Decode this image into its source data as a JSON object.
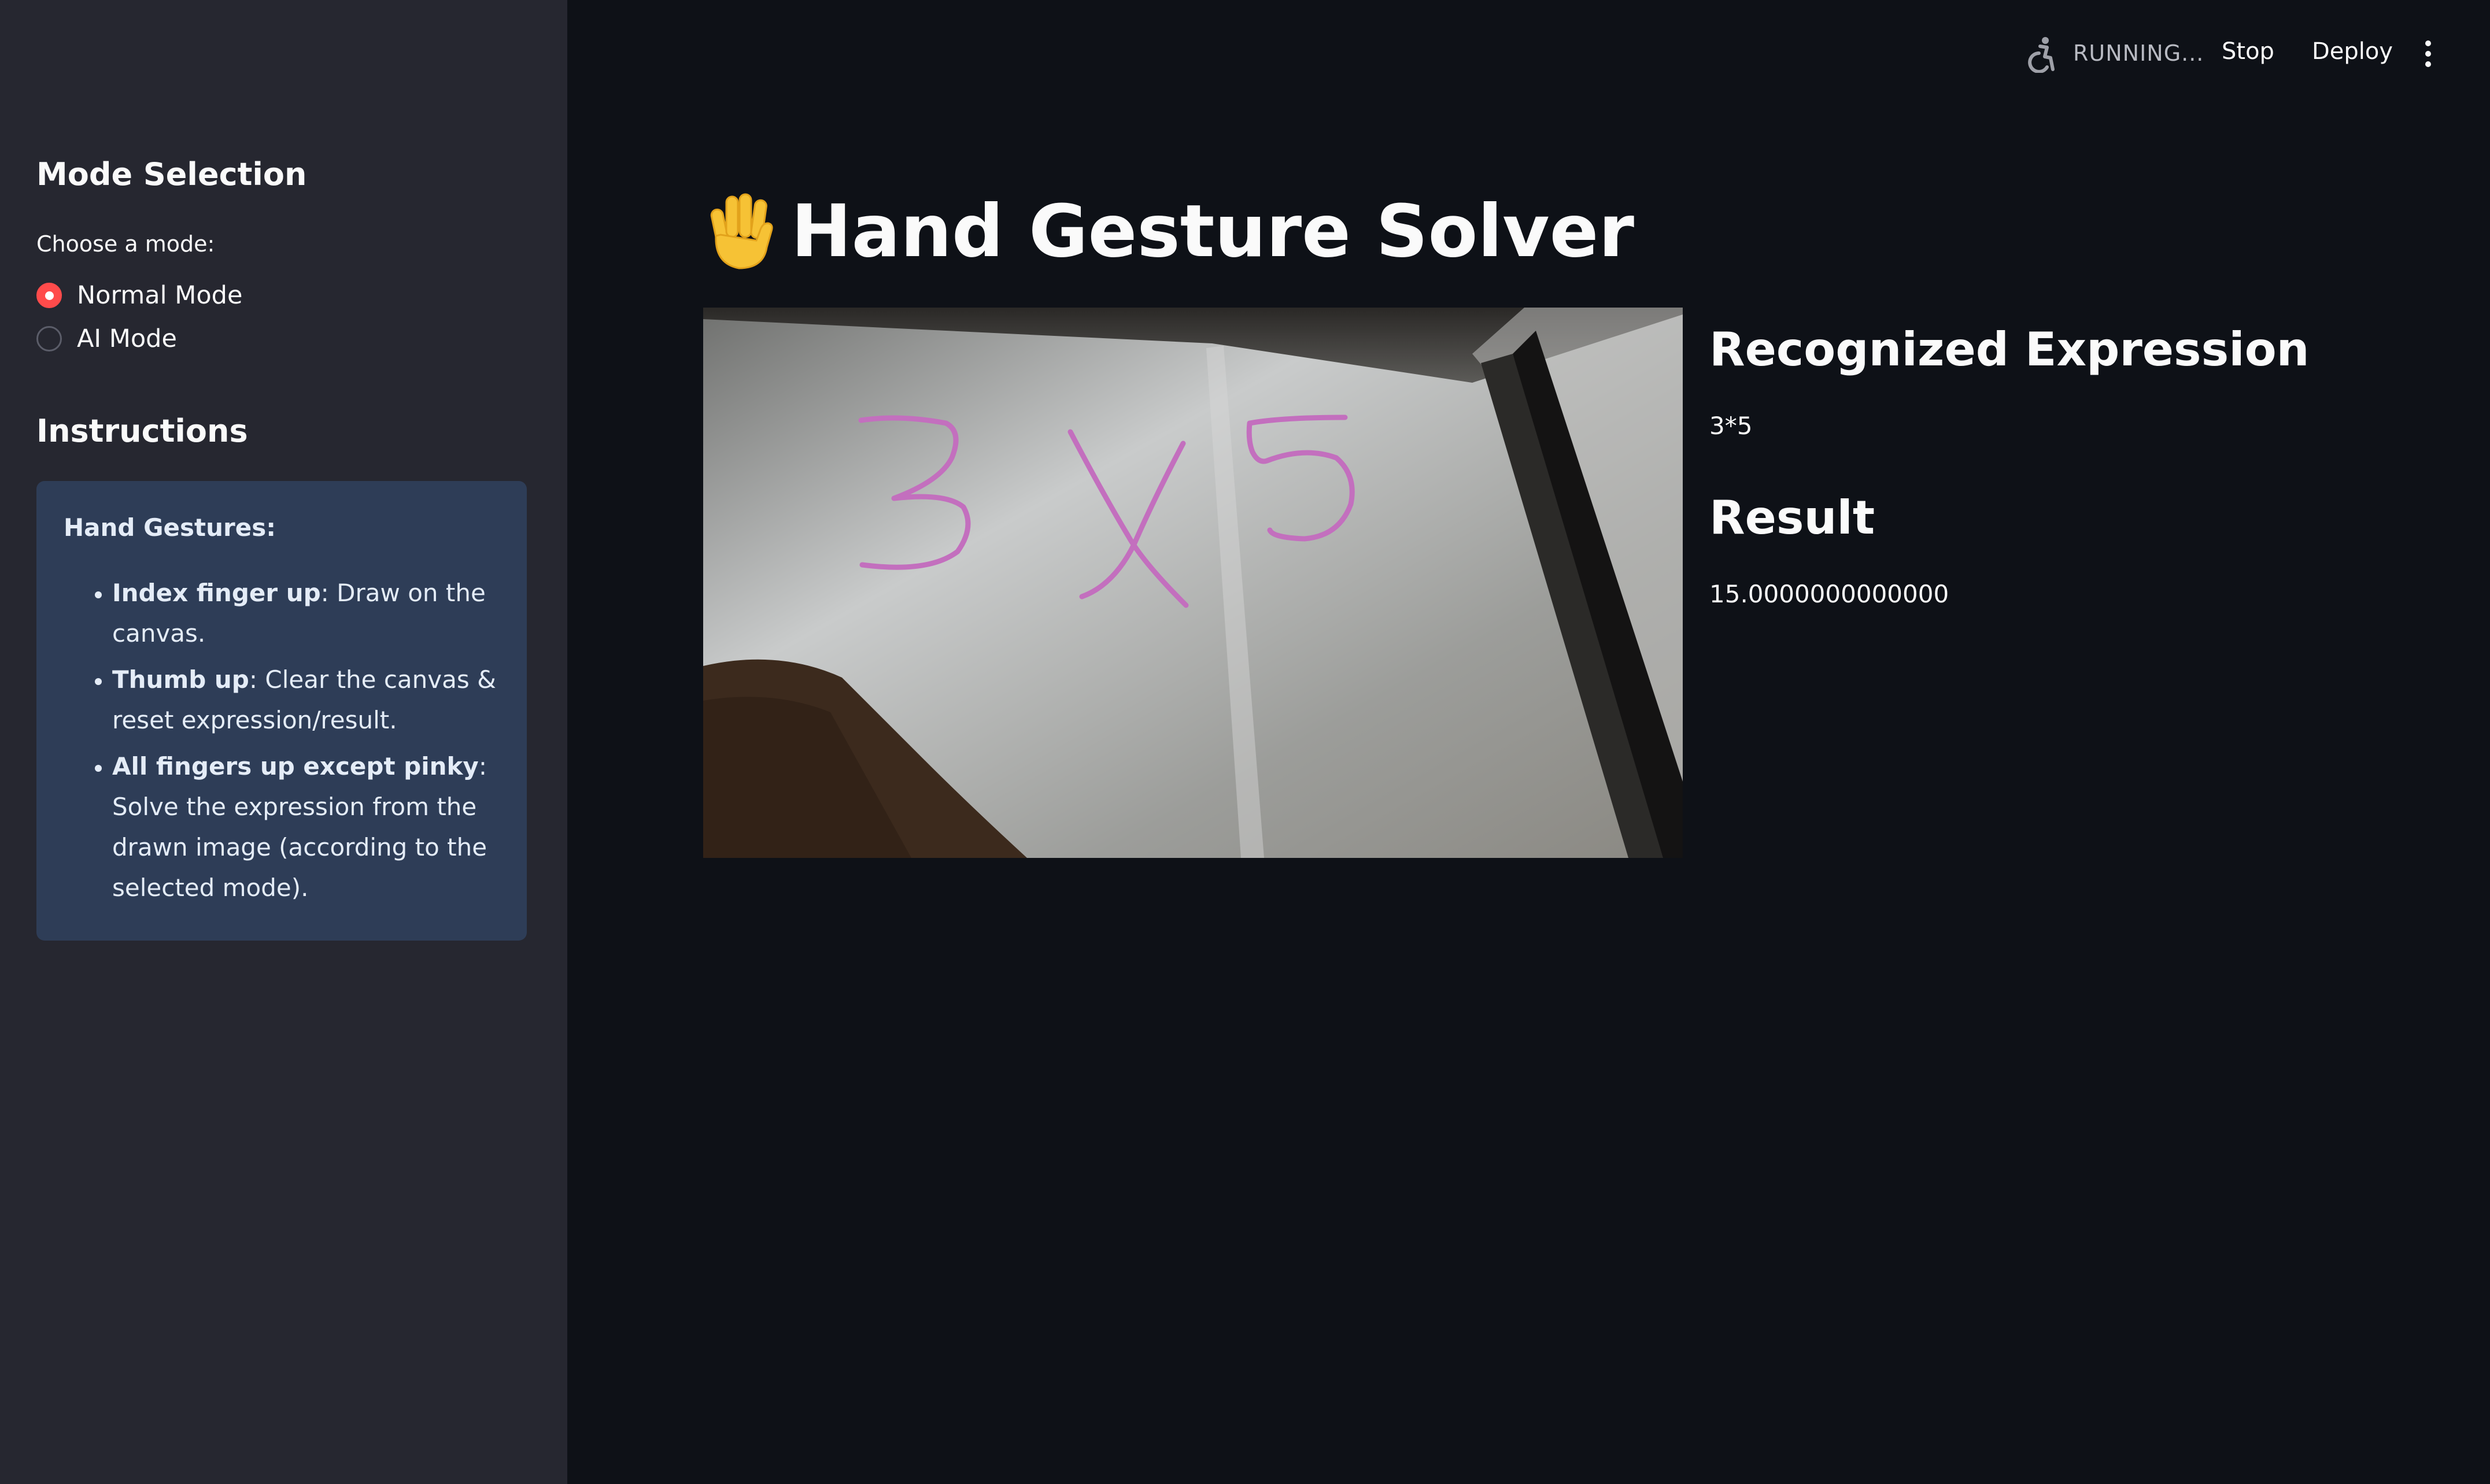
{
  "sidebar": {
    "mode_heading": "Mode Selection",
    "choose_label": "Choose a mode:",
    "modes": [
      {
        "label": "Normal Mode",
        "selected": true
      },
      {
        "label": "AI Mode",
        "selected": false
      }
    ],
    "instructions_heading": "Instructions",
    "instructions": {
      "title": "Hand Gestures:",
      "items": [
        {
          "bold": "Index finger up",
          "text": ": Draw on the canvas."
        },
        {
          "bold": "Thumb up",
          "text": ": Clear the canvas & reset expression/result."
        },
        {
          "bold": "All fingers up except pinky",
          "text": ": Solve the expression from the drawn image (according to the selected mode)."
        }
      ]
    }
  },
  "header": {
    "status": "RUNNING...",
    "status_icon": "running-person-icon",
    "stop_label": "Stop",
    "deploy_label": "Deploy",
    "menu_icon": "kebab-menu-icon"
  },
  "main": {
    "title_icon": "raised-hand-icon",
    "title": "Hand Gesture Solver",
    "recognized_heading": "Recognized Expression",
    "recognized_value": "3*5",
    "result_heading": "Result",
    "result_value": "15.0000000000000",
    "canvas_drawing": "3 X 5"
  },
  "colors": {
    "app_bg": "#0e1117",
    "sidebar_bg": "#262730",
    "info_box_bg": "#2e3d57",
    "accent_red": "#ff4b4b",
    "drawing_stroke": "#c36fbe"
  }
}
